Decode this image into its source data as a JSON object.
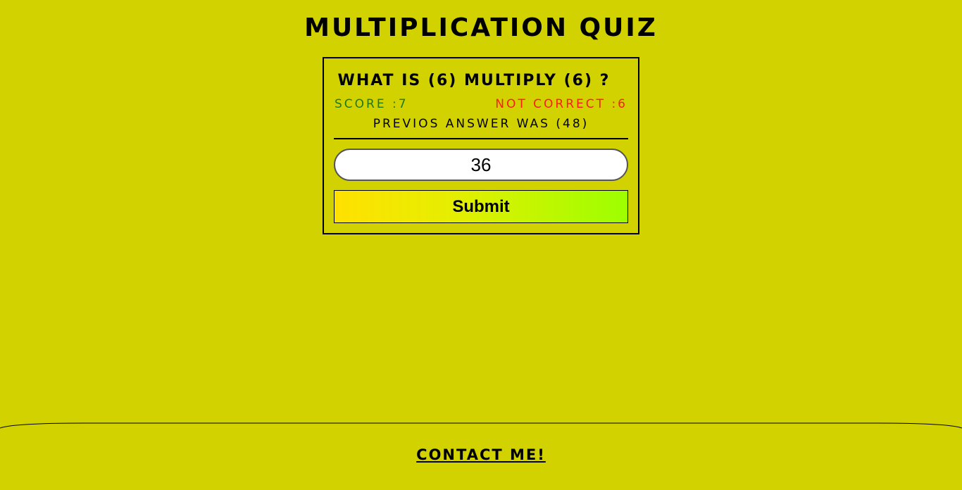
{
  "header": {
    "title": "MULTIPLICATION QUIZ"
  },
  "quiz": {
    "question": "WHAT IS (6) MULTIPLY (6) ?",
    "score_text": "SCORE :7",
    "not_correct_text": "NOT CORRECT :6",
    "previous_answer_text": "PREVIOS ANSWER WAS (48)",
    "answer_value": "36",
    "submit_label": "Submit"
  },
  "footer": {
    "contact_label": "CONTACT ME!"
  },
  "colors": {
    "background": "#d2d200",
    "score": "#1f7a14",
    "not_correct": "#ff1a1a",
    "submit_gradient_start": "#ffe100",
    "submit_gradient_end": "#9dff00"
  }
}
